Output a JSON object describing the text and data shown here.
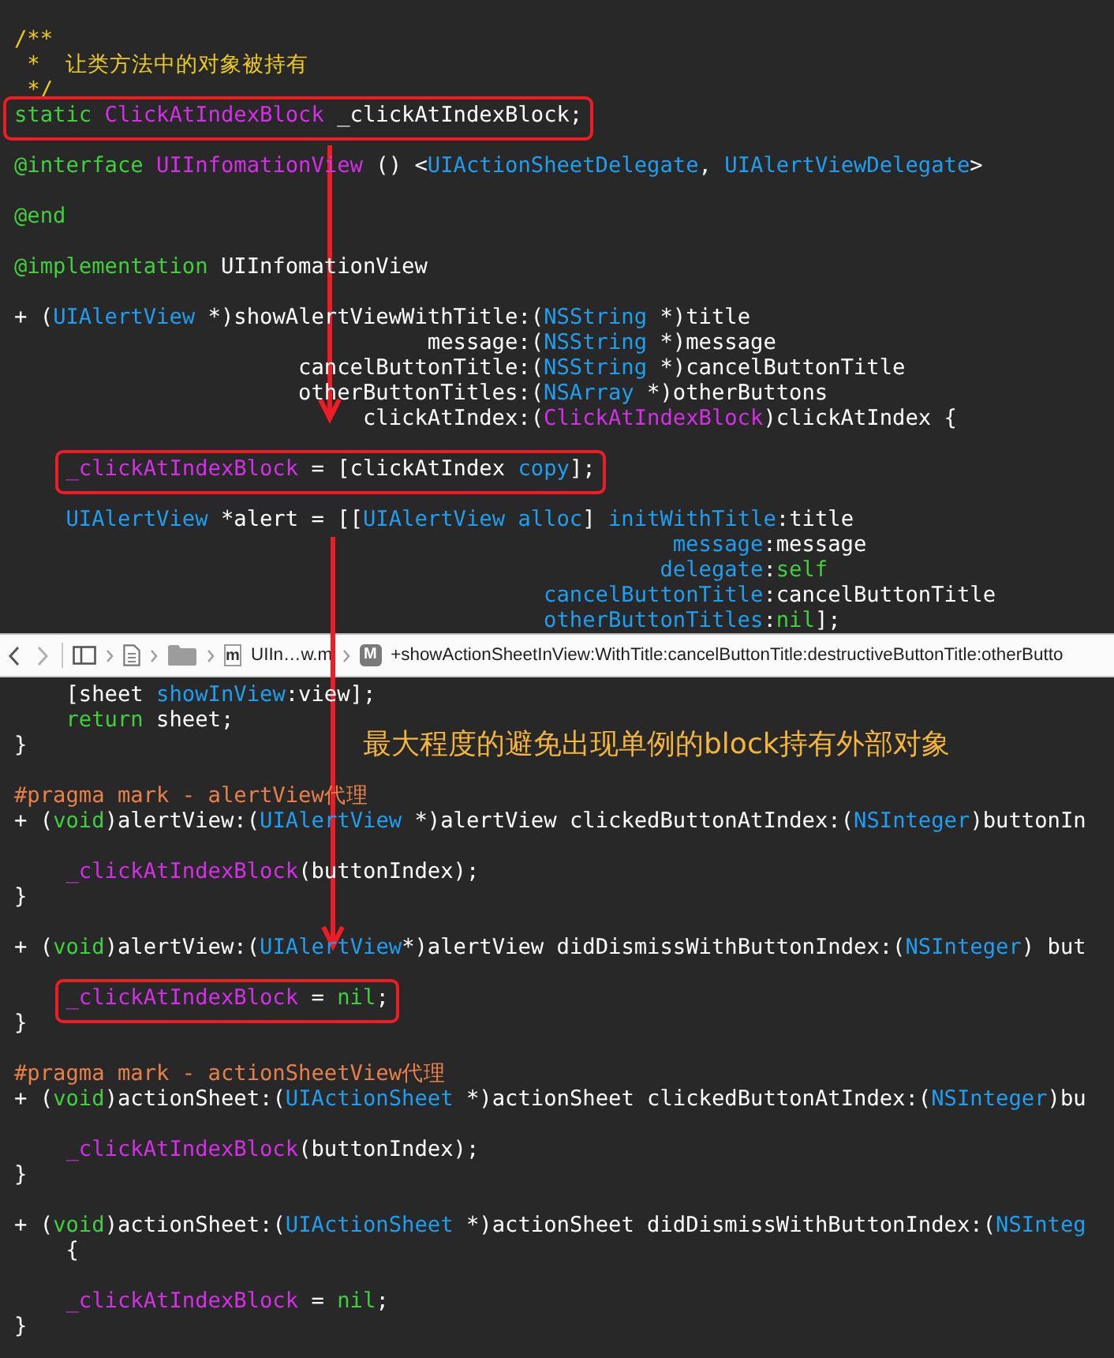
{
  "code_top": {
    "blocks": [
      {
        "lines": [
          {
            "boxed": false,
            "tokens": [
              {
                "kind": "comment",
                "text": "/**"
              }
            ]
          },
          {
            "boxed": false,
            "tokens": [
              {
                "kind": "comment",
                "text": " *  让类方法中的对象被持有"
              }
            ]
          },
          {
            "boxed": false,
            "tokens": [
              {
                "kind": "comment",
                "text": " */"
              }
            ]
          },
          {
            "boxed": true,
            "tokens": [
              {
                "kind": "keyword",
                "text": "static "
              },
              {
                "kind": "type",
                "text": "ClickAtIndexBlock"
              },
              {
                "kind": "plain",
                "text": " _clickAtIndexBlock;"
              }
            ]
          }
        ]
      },
      {
        "lines": [
          {
            "boxed": false,
            "tokens": [
              {
                "kind": "keyword",
                "text": "@interface "
              },
              {
                "kind": "type",
                "text": "UIInfomationView"
              },
              {
                "kind": "plain",
                "text": " () <"
              },
              {
                "kind": "class",
                "text": "UIActionSheetDelegate"
              },
              {
                "kind": "plain",
                "text": ", "
              },
              {
                "kind": "class",
                "text": "UIAlertViewDelegate"
              },
              {
                "kind": "plain",
                "text": ">"
              }
            ]
          }
        ]
      },
      {
        "lines": [
          {
            "boxed": false,
            "tokens": [
              {
                "kind": "keyword",
                "text": "@end"
              }
            ]
          }
        ]
      },
      {
        "lines": [
          {
            "boxed": false,
            "tokens": [
              {
                "kind": "keyword",
                "text": "@implementation"
              },
              {
                "kind": "plain",
                "text": " UIInfomationView"
              }
            ]
          }
        ]
      },
      {
        "lines": [
          {
            "boxed": false,
            "tokens": [
              {
                "kind": "plain",
                "text": "+ ("
              },
              {
                "kind": "class",
                "text": "UIAlertView"
              },
              {
                "kind": "plain",
                "text": " *)showAlertViewWithTitle:("
              },
              {
                "kind": "class",
                "text": "NSString"
              },
              {
                "kind": "plain",
                "text": " *)title"
              }
            ]
          },
          {
            "boxed": false,
            "tokens": [
              {
                "kind": "plain",
                "text": "                                message:("
              },
              {
                "kind": "class",
                "text": "NSString"
              },
              {
                "kind": "plain",
                "text": " *)message"
              }
            ]
          },
          {
            "boxed": false,
            "tokens": [
              {
                "kind": "plain",
                "text": "                      cancelButtonTitle:("
              },
              {
                "kind": "class",
                "text": "NSString"
              },
              {
                "kind": "plain",
                "text": " *)cancelButtonTitle"
              }
            ]
          },
          {
            "boxed": false,
            "tokens": [
              {
                "kind": "plain",
                "text": "                      otherButtonTitles:("
              },
              {
                "kind": "class",
                "text": "NSArray"
              },
              {
                "kind": "plain",
                "text": " *)otherButtons"
              }
            ]
          },
          {
            "boxed": false,
            "tokens": [
              {
                "kind": "plain",
                "text": "                           clickAtIndex:("
              },
              {
                "kind": "type",
                "text": "ClickAtIndexBlock"
              },
              {
                "kind": "plain",
                "text": ")clickAtIndex {"
              }
            ]
          }
        ]
      },
      {
        "lines": [
          {
            "boxed": true,
            "tokens": [
              {
                "kind": "type",
                "text": "    _clickAtIndexBlock"
              },
              {
                "kind": "plain",
                "text": " = [clickAtIndex "
              },
              {
                "kind": "class",
                "text": "copy"
              },
              {
                "kind": "plain",
                "text": "];"
              }
            ]
          }
        ]
      },
      {
        "lines": [
          {
            "boxed": false,
            "tokens": [
              {
                "kind": "class",
                "text": "    UIAlertView"
              },
              {
                "kind": "plain",
                "text": " *alert = [["
              },
              {
                "kind": "class",
                "text": "UIAlertView alloc"
              },
              {
                "kind": "plain",
                "text": "] "
              },
              {
                "kind": "class",
                "text": "initWithTitle"
              },
              {
                "kind": "plain",
                "text": ":title"
              }
            ]
          },
          {
            "boxed": false,
            "tokens": [
              {
                "kind": "class",
                "text": "                                                   message"
              },
              {
                "kind": "plain",
                "text": ":message"
              }
            ]
          },
          {
            "boxed": false,
            "tokens": [
              {
                "kind": "class",
                "text": "                                                  delegate"
              },
              {
                "kind": "plain",
                "text": ":"
              },
              {
                "kind": "keyword",
                "text": "self"
              }
            ]
          },
          {
            "boxed": false,
            "tokens": [
              {
                "kind": "class",
                "text": "                                         cancelButtonTitle"
              },
              {
                "kind": "plain",
                "text": ":cancelButtonTitle"
              }
            ]
          },
          {
            "boxed": false,
            "tokens": [
              {
                "kind": "class",
                "text": "                                         otherButtonTitles"
              },
              {
                "kind": "plain",
                "text": ":"
              },
              {
                "kind": "keyword",
                "text": "nil"
              },
              {
                "kind": "plain",
                "text": "];"
              }
            ]
          }
        ]
      }
    ]
  },
  "jump_bar": {
    "file_icon_letter": "m",
    "file_name": "UIIn…w.m",
    "method_badge": "M",
    "method": "+showActionSheetInView:WithTitle:cancelButtonTitle:destructiveButtonTitle:otherButto"
  },
  "annotation": "最大程度的避免出现单例的block持有外部对象",
  "code_bottom": {
    "blocks": [
      {
        "lines": [
          {
            "boxed": false,
            "tokens": [
              {
                "kind": "plain",
                "text": "    [sheet "
              },
              {
                "kind": "class",
                "text": "showInView"
              },
              {
                "kind": "plain",
                "text": ":view];"
              }
            ]
          },
          {
            "boxed": false,
            "tokens": [
              {
                "kind": "keyword",
                "text": "    return"
              },
              {
                "kind": "plain",
                "text": " sheet;"
              }
            ]
          },
          {
            "boxed": false,
            "tokens": [
              {
                "kind": "plain",
                "text": "}"
              }
            ]
          }
        ]
      },
      {
        "lines": [
          {
            "boxed": false,
            "tokens": [
              {
                "kind": "preprocessor",
                "text": "#pragma mark - alertView代理"
              }
            ]
          },
          {
            "boxed": false,
            "tokens": [
              {
                "kind": "plain",
                "text": "+ ("
              },
              {
                "kind": "keyword",
                "text": "void"
              },
              {
                "kind": "plain",
                "text": ")alertView:("
              },
              {
                "kind": "class",
                "text": "UIAlertView"
              },
              {
                "kind": "plain",
                "text": " *)alertView clickedButtonAtIndex:("
              },
              {
                "kind": "class",
                "text": "NSInteger"
              },
              {
                "kind": "plain",
                "text": ")buttonIn"
              }
            ]
          }
        ]
      },
      {
        "lines": [
          {
            "boxed": false,
            "tokens": [
              {
                "kind": "type",
                "text": "    _clickAtIndexBlock"
              },
              {
                "kind": "plain",
                "text": "(buttonIndex);"
              }
            ]
          },
          {
            "boxed": false,
            "tokens": [
              {
                "kind": "plain",
                "text": "}"
              }
            ]
          }
        ]
      },
      {
        "lines": [
          {
            "boxed": false,
            "tokens": [
              {
                "kind": "plain",
                "text": "+ ("
              },
              {
                "kind": "keyword",
                "text": "void"
              },
              {
                "kind": "plain",
                "text": ")alertView:("
              },
              {
                "kind": "class",
                "text": "UIAlertView"
              },
              {
                "kind": "plain",
                "text": "*)alertView didDismissWithButtonIndex:("
              },
              {
                "kind": "class",
                "text": "NSInteger"
              },
              {
                "kind": "plain",
                "text": ") but"
              }
            ]
          }
        ]
      },
      {
        "lines": [
          {
            "boxed": true,
            "tokens": [
              {
                "kind": "type",
                "text": "    _clickAtIndexBlock"
              },
              {
                "kind": "plain",
                "text": " = "
              },
              {
                "kind": "keyword",
                "text": "nil"
              },
              {
                "kind": "plain",
                "text": ";"
              }
            ]
          },
          {
            "boxed": false,
            "tokens": [
              {
                "kind": "plain",
                "text": "}"
              }
            ]
          }
        ]
      },
      {
        "lines": [
          {
            "boxed": false,
            "tokens": [
              {
                "kind": "preprocessor",
                "text": "#pragma mark - actionSheetView代理"
              }
            ]
          },
          {
            "boxed": false,
            "tokens": [
              {
                "kind": "plain",
                "text": "+ ("
              },
              {
                "kind": "keyword",
                "text": "void"
              },
              {
                "kind": "plain",
                "text": ")actionSheet:("
              },
              {
                "kind": "class",
                "text": "UIActionSheet"
              },
              {
                "kind": "plain",
                "text": " *)actionSheet clickedButtonAtIndex:("
              },
              {
                "kind": "class",
                "text": "NSInteger"
              },
              {
                "kind": "plain",
                "text": ")bu"
              }
            ]
          }
        ]
      },
      {
        "lines": [
          {
            "boxed": false,
            "tokens": [
              {
                "kind": "type",
                "text": "    _clickAtIndexBlock"
              },
              {
                "kind": "plain",
                "text": "(buttonIndex);"
              }
            ]
          },
          {
            "boxed": false,
            "tokens": [
              {
                "kind": "plain",
                "text": "}"
              }
            ]
          }
        ]
      },
      {
        "lines": [
          {
            "boxed": false,
            "tokens": [
              {
                "kind": "plain",
                "text": "+ ("
              },
              {
                "kind": "keyword",
                "text": "void"
              },
              {
                "kind": "plain",
                "text": ")actionSheet:("
              },
              {
                "kind": "class",
                "text": "UIActionSheet"
              },
              {
                "kind": "plain",
                "text": " *)actionSheet didDismissWithButtonIndex:("
              },
              {
                "kind": "class",
                "text": "NSInteg"
              }
            ]
          },
          {
            "boxed": false,
            "tokens": [
              {
                "kind": "plain",
                "text": "    {"
              }
            ]
          }
        ]
      },
      {
        "lines": [
          {
            "boxed": false,
            "tokens": [
              {
                "kind": "type",
                "text": "    _clickAtIndexBlock"
              },
              {
                "kind": "plain",
                "text": " = "
              },
              {
                "kind": "keyword",
                "text": "nil"
              },
              {
                "kind": "plain",
                "text": ";"
              }
            ]
          },
          {
            "boxed": false,
            "tokens": [
              {
                "kind": "plain",
                "text": "}"
              }
            ]
          }
        ]
      }
    ]
  }
}
